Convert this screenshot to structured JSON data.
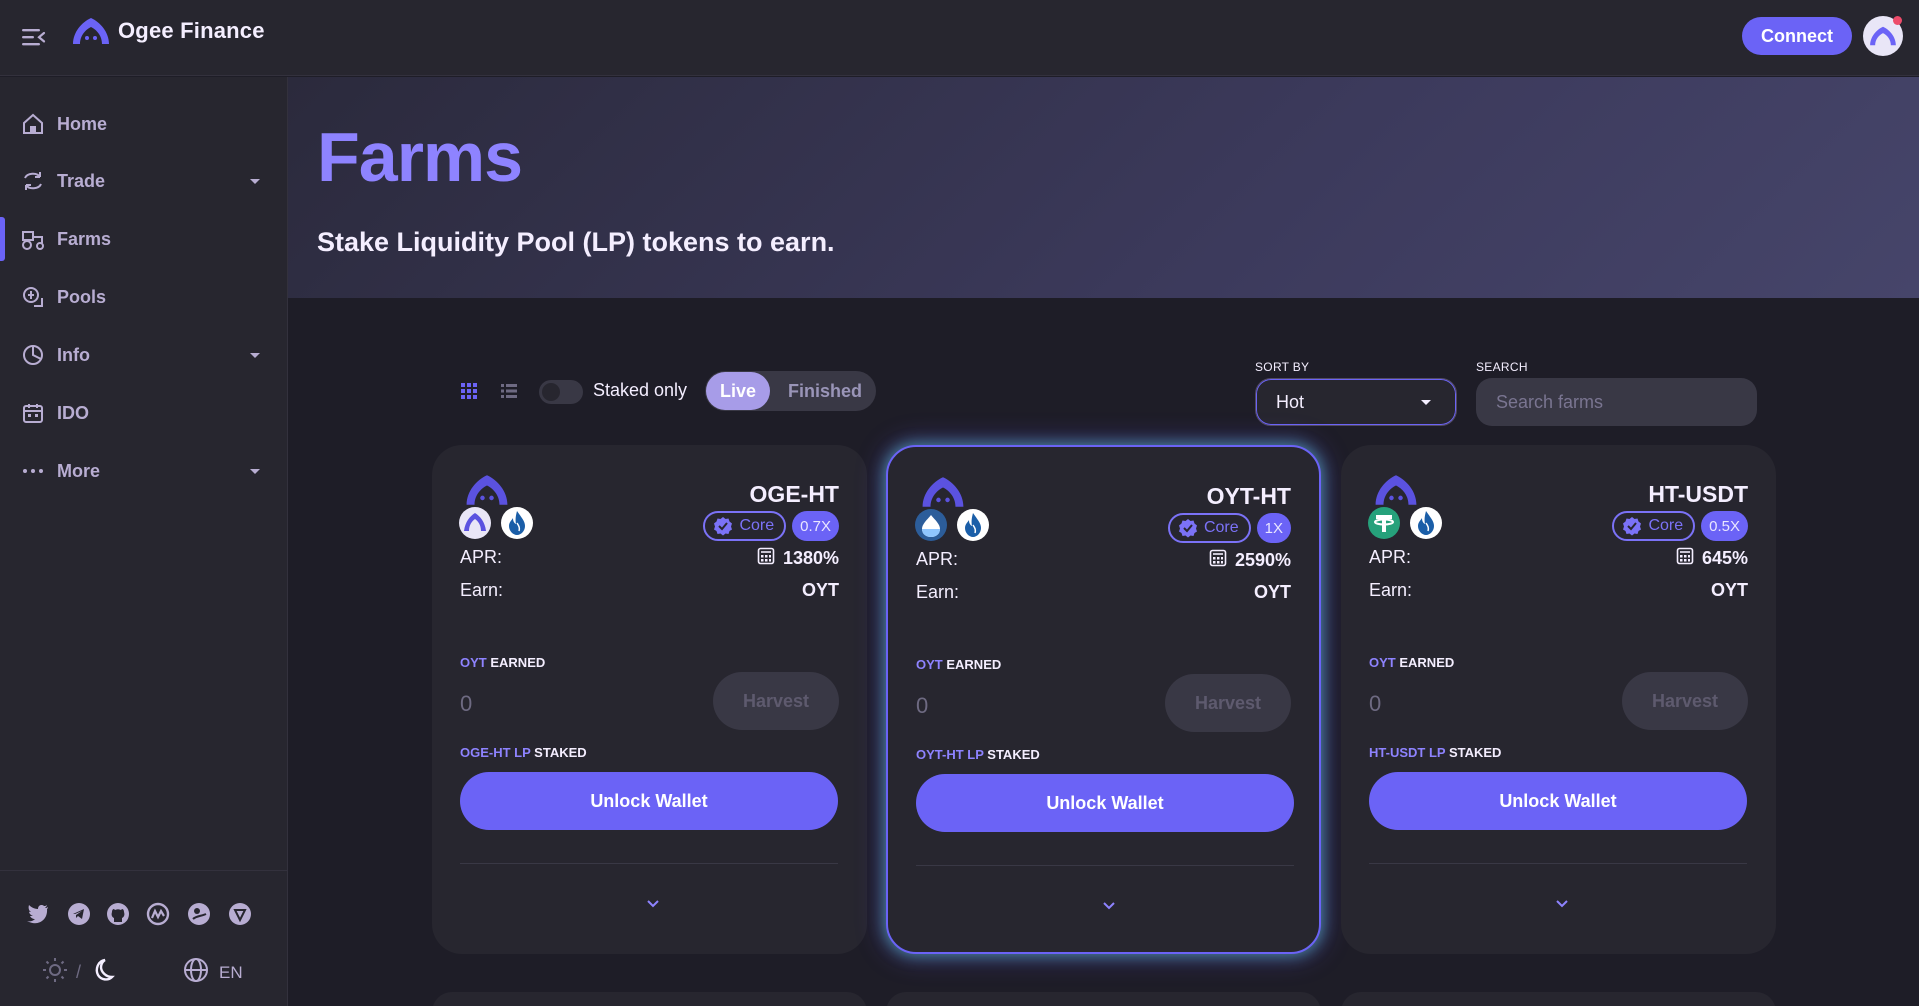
{
  "header": {
    "brand": "Ogee Finance",
    "connect_label": "Connect"
  },
  "sidebar": {
    "items": [
      {
        "label": "Home",
        "icon": "home-icon",
        "expandable": false,
        "active": false
      },
      {
        "label": "Trade",
        "icon": "trade-icon",
        "expandable": true,
        "active": false
      },
      {
        "label": "Farms",
        "icon": "farms-icon",
        "expandable": false,
        "active": true
      },
      {
        "label": "Pools",
        "icon": "pools-icon",
        "expandable": false,
        "active": false
      },
      {
        "label": "Info",
        "icon": "info-icon",
        "expandable": true,
        "active": false
      },
      {
        "label": "IDO",
        "icon": "ido-icon",
        "expandable": false,
        "active": false
      },
      {
        "label": "More",
        "icon": "more-icon",
        "expandable": true,
        "active": false
      }
    ],
    "socials": [
      "twitter-icon",
      "telegram-icon",
      "github-icon",
      "coinmarketcap-icon",
      "coingecko-icon",
      "shield-icon"
    ],
    "theme_separator": "/",
    "language": "EN"
  },
  "hero": {
    "title": "Farms",
    "subtitle": "Stake Liquidity Pool (LP) tokens to earn."
  },
  "controls": {
    "staked_only_label": "Staked only",
    "live_label": "Live",
    "finished_label": "Finished",
    "sort_by_label": "SORT BY",
    "sort_value": "Hot",
    "search_label": "SEARCH",
    "search_placeholder": "Search farms"
  },
  "colors": {
    "accent": "#6b63f6",
    "accent_light": "#8e83ff",
    "card_bg": "#27262f",
    "page_bg": "#1e1d27"
  },
  "farms": [
    {
      "pair": "OGE-HT",
      "core_label": "Core",
      "multiplier": "0.7X",
      "apr_label": "APR:",
      "apr": "1380%",
      "earn_label": "Earn:",
      "earn": "OYT",
      "earned_token": "OYT",
      "earned_label": "EARNED",
      "earned_value": "0",
      "harvest_label": "Harvest",
      "lp_token": "OGE-HT LP",
      "staked_label": "STAKED",
      "unlock_label": "Unlock Wallet",
      "details_label": "Details",
      "token_a": "oge-token-icon",
      "token_b": "ht-token-icon",
      "featured": false
    },
    {
      "pair": "OYT-HT",
      "core_label": "Core",
      "multiplier": "1X",
      "apr_label": "APR:",
      "apr": "2590%",
      "earn_label": "Earn:",
      "earn": "OYT",
      "earned_token": "OYT",
      "earned_label": "EARNED",
      "earned_value": "0",
      "harvest_label": "Harvest",
      "lp_token": "OYT-HT LP",
      "staked_label": "STAKED",
      "unlock_label": "Unlock Wallet",
      "details_label": "Details",
      "token_a": "oyt-token-icon",
      "token_b": "ht-token-icon",
      "featured": true
    },
    {
      "pair": "HT-USDT",
      "core_label": "Core",
      "multiplier": "0.5X",
      "apr_label": "APR:",
      "apr": "645%",
      "earn_label": "Earn:",
      "earn": "OYT",
      "earned_token": "OYT",
      "earned_label": "EARNED",
      "earned_value": "0",
      "harvest_label": "Harvest",
      "lp_token": "HT-USDT LP",
      "staked_label": "STAKED",
      "unlock_label": "Unlock Wallet",
      "details_label": "Details",
      "token_a": "usdt-token-icon",
      "token_b": "ht-token-icon",
      "featured": false
    }
  ]
}
